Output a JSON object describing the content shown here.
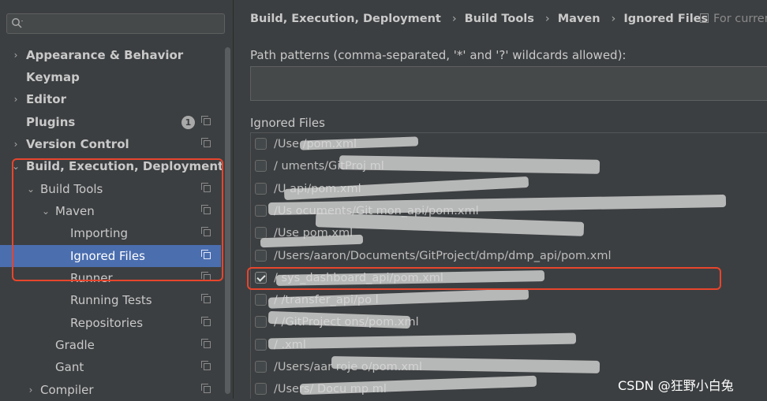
{
  "search": {
    "placeholder": "Q▾"
  },
  "sidebar": {
    "items": [
      {
        "label": "Appearance & Behavior",
        "arrow": "›",
        "level": 0,
        "bold": true,
        "copy": false
      },
      {
        "label": "Keymap",
        "arrow": "",
        "level": 0,
        "bold": true,
        "copy": false
      },
      {
        "label": "Editor",
        "arrow": "›",
        "level": 0,
        "bold": true,
        "copy": false
      },
      {
        "label": "Plugins",
        "arrow": "",
        "level": 0,
        "bold": true,
        "copy": true,
        "badge": "1"
      },
      {
        "label": "Version Control",
        "arrow": "›",
        "level": 0,
        "bold": true,
        "copy": true
      },
      {
        "label": "Build, Execution, Deployment",
        "arrow": "⌄",
        "level": 0,
        "bold": true,
        "copy": false
      },
      {
        "label": "Build Tools",
        "arrow": "⌄",
        "level": 1,
        "bold": false,
        "copy": true
      },
      {
        "label": "Maven",
        "arrow": "⌄",
        "level": 2,
        "bold": false,
        "copy": true
      },
      {
        "label": "Importing",
        "arrow": "",
        "level": 3,
        "bold": false,
        "copy": true
      },
      {
        "label": "Ignored Files",
        "arrow": "",
        "level": 3,
        "bold": false,
        "copy": true,
        "selected": true
      },
      {
        "label": "Runner",
        "arrow": "",
        "level": 3,
        "bold": false,
        "copy": true
      },
      {
        "label": "Running Tests",
        "arrow": "",
        "level": 3,
        "bold": false,
        "copy": true
      },
      {
        "label": "Repositories",
        "arrow": "",
        "level": 3,
        "bold": false,
        "copy": true
      },
      {
        "label": "Gradle",
        "arrow": "",
        "level": 2,
        "bold": false,
        "copy": true
      },
      {
        "label": "Gant",
        "arrow": "",
        "level": 2,
        "bold": false,
        "copy": true
      },
      {
        "label": "Compiler",
        "arrow": "›",
        "level": 1,
        "bold": false,
        "copy": true
      }
    ]
  },
  "breadcrumb": [
    "Build, Execution, Deployment",
    "Build Tools",
    "Maven",
    "Ignored Files"
  ],
  "scope_label": "For curren",
  "path_patterns": {
    "label": "Path patterns (comma-separated, '*' and '?' wildcards allowed):",
    "value": ""
  },
  "ignored_files": {
    "label": "Ignored Files",
    "rows": [
      {
        "path": "/Use                                         /pom.xml",
        "checked": false
      },
      {
        "path": "/                        uments/GitProj                                       ml",
        "checked": false
      },
      {
        "path": "/U                                                                       api/pom.xml",
        "checked": false
      },
      {
        "path": "/Us                  ocuments/Git                                       mon_api/pom.xml",
        "checked": false
      },
      {
        "path": "/Use                                                                    pom.xml",
        "checked": false
      },
      {
        "path": "/Users/aaron/Documents/GitProject/dmp/dmp_api/pom.xml",
        "checked": false
      },
      {
        "path": "/                                                      sys_dashboard_api/pom.xml",
        "checked": true
      },
      {
        "path": "/                                                    /transfer_api/po      l",
        "checked": false
      },
      {
        "path": "/                               /GitProject                    ons/pom.xml",
        "checked": false
      },
      {
        "path": "/                                                                          .xml",
        "checked": false
      },
      {
        "path": "/Users/aar                            roje                          o/pom.xml",
        "checked": false
      },
      {
        "path": "/Users/            Docu                       mp                          ml",
        "checked": false
      }
    ]
  },
  "watermark": "CSDN @狂野小白兔",
  "colors": {
    "selection": "#4b6eaf",
    "highlight_box": "#e8452c",
    "background": "#3c3f41"
  }
}
